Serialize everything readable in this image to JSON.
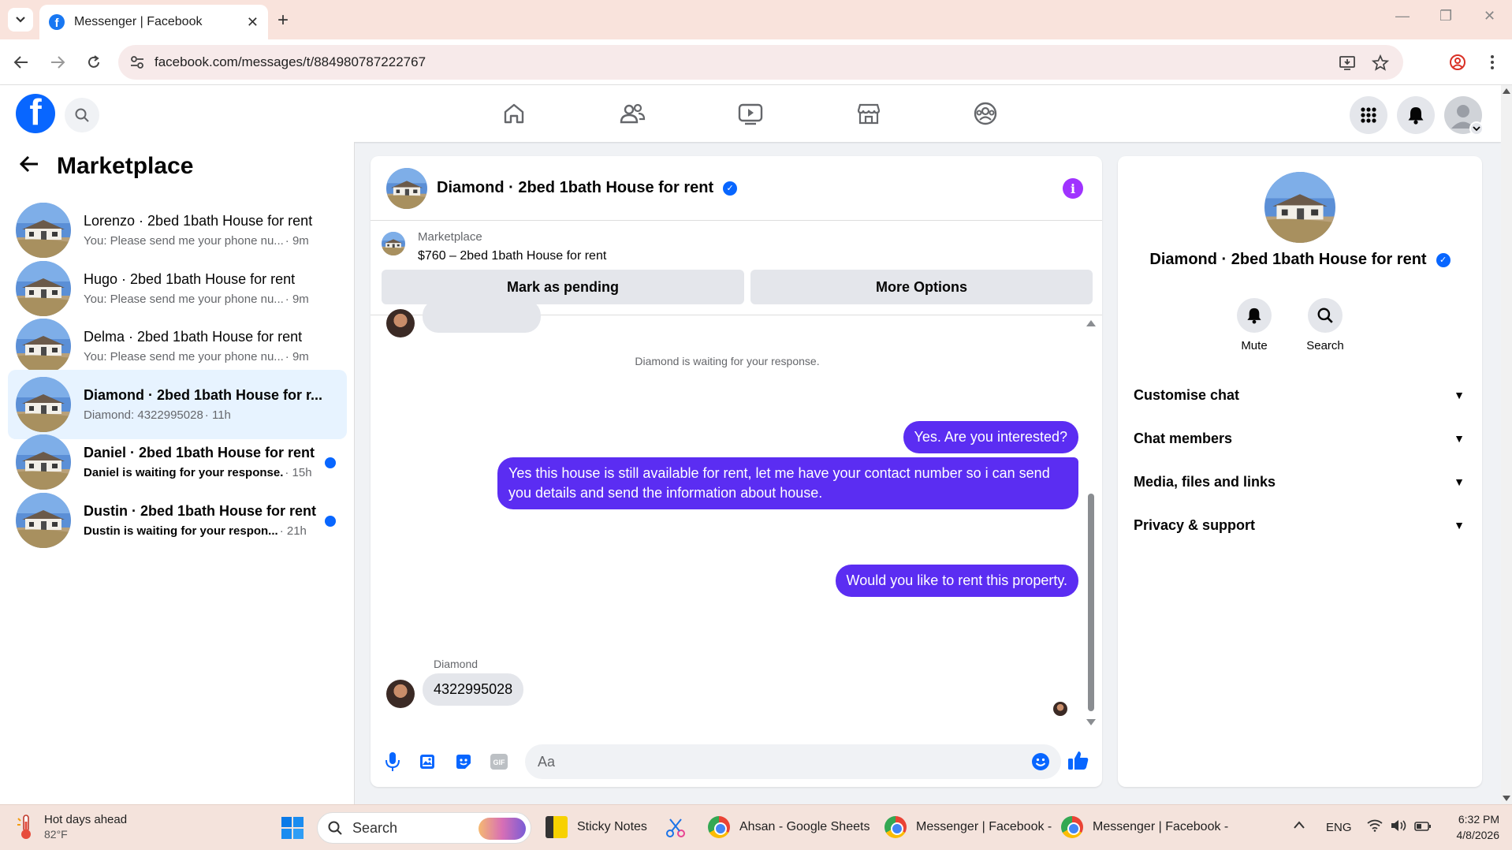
{
  "browser": {
    "tab_title": "Messenger | Facebook",
    "url": "facebook.com/messages/t/884980787222767"
  },
  "left": {
    "title": "Marketplace",
    "conversations": [
      {
        "name": "Lorenzo · 2bed 1bath House for rent",
        "preview": "You: Please send me your phone nu...",
        "time": "· 9m",
        "active": false,
        "unread": false
      },
      {
        "name": "Hugo · 2bed 1bath House for rent",
        "preview": "You: Please send me your phone nu...",
        "time": "· 9m",
        "active": false,
        "unread": false
      },
      {
        "name": "Delma · 2bed 1bath House for rent",
        "preview": "You: Please send me your phone nu...",
        "time": "· 9m",
        "active": false,
        "unread": false
      },
      {
        "name": "Diamond · 2bed 1bath House for r...",
        "preview": "Diamond: 4322995028",
        "time": "· 11h",
        "active": true,
        "unread": false
      },
      {
        "name": "Daniel · 2bed 1bath House for rent",
        "preview": "Daniel is waiting for your response.",
        "time": "· 15h",
        "active": false,
        "unread": true
      },
      {
        "name": "Dustin · 2bed 1bath House for rent",
        "preview": "Dustin is waiting for your respon...",
        "time": "· 21h",
        "active": false,
        "unread": true
      }
    ]
  },
  "chat": {
    "title": "Diamond · 2bed 1bath House for rent",
    "marketplace_label": "Marketplace",
    "listing": "$760 – 2bed 1bath House for rent",
    "btn_pending": "Mark as pending",
    "btn_more": "More Options",
    "system_msg": "Diamond is waiting for your response.",
    "out_msg1": "Yes. Are you interested?",
    "out_msg2": "Yes this house is still available for rent, let me have your contact number so i can send you details and send the information about house.",
    "out_msg3": "Would you like to rent this property.",
    "sender_name": "Diamond",
    "in_msg": "4322995028",
    "composer_placeholder": "Aa"
  },
  "info": {
    "name": "Diamond · 2bed 1bath House for rent",
    "mute_label": "Mute",
    "search_label": "Search",
    "rows": [
      "Customise chat",
      "Chat members",
      "Media, files and links",
      "Privacy & support"
    ]
  },
  "taskbar": {
    "weather_title": "Hot days ahead",
    "weather_temp": "82°F",
    "search_label": "Search",
    "app_sticky": "Sticky Notes",
    "app_sheets": "Ahsan - Google Sheets",
    "app_msg1": "Messenger | Facebook -",
    "app_msg2": "Messenger | Facebook -",
    "lang": "ENG",
    "time": "6:32 PM",
    "date": "4/8/2026"
  },
  "colors": {
    "brand": "#0866ff",
    "outgoing_bubble": "#5b2df2",
    "active_row": "#e7f3ff",
    "info_accent": "#a033ff"
  }
}
